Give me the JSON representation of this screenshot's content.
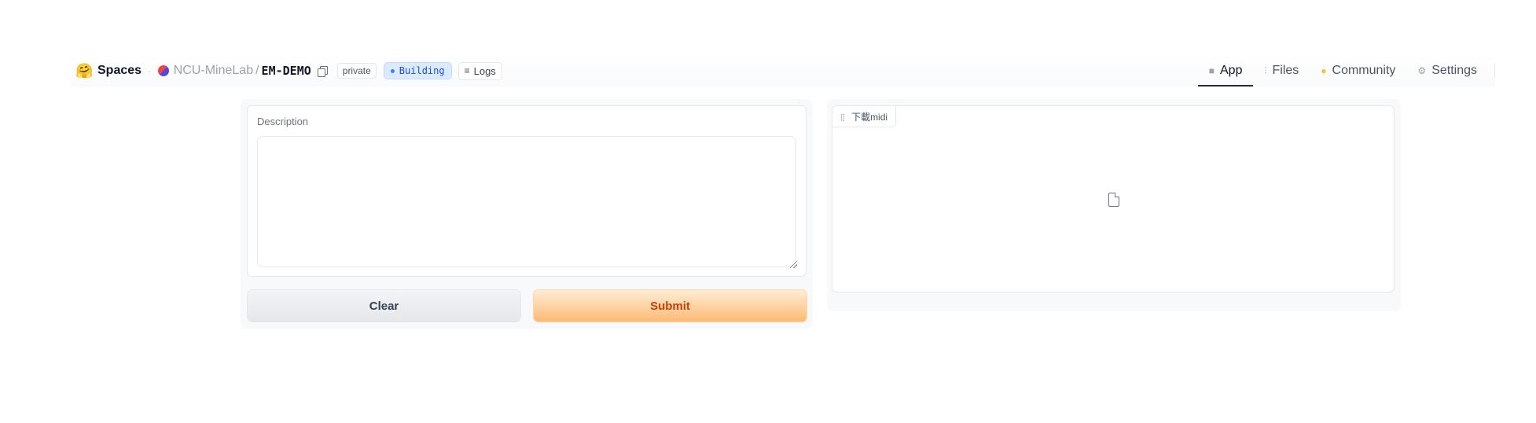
{
  "header": {
    "logo_emoji": "🤗",
    "spaces_label": "Spaces",
    "org": "NCU-MineLab",
    "slash": "/",
    "repo": "EM-DEMO",
    "visibility_badge": "private",
    "status_badge": "Building",
    "logs_label": "Logs",
    "logs_icon": "≡"
  },
  "nav": {
    "app": {
      "icon": "app-cube-icon",
      "glyph": "■",
      "label": "App"
    },
    "files": {
      "icon": "files-icon",
      "glyph": "⫶",
      "label": "Files"
    },
    "community": {
      "icon": "community-icon",
      "glyph": "●",
      "label": "Community"
    },
    "settings": {
      "icon": "gear-icon",
      "glyph": "⚙",
      "label": "Settings"
    }
  },
  "form": {
    "description_label": "Description",
    "description_value": "",
    "clear_label": "Clear",
    "submit_label": "Submit"
  },
  "output": {
    "file_label": "下載midi",
    "file_label_icon": "file-icon"
  },
  "colors": {
    "submit_text": "#c2410c",
    "building_bg": "#dbeafe",
    "building_text": "#1d4ed8"
  }
}
